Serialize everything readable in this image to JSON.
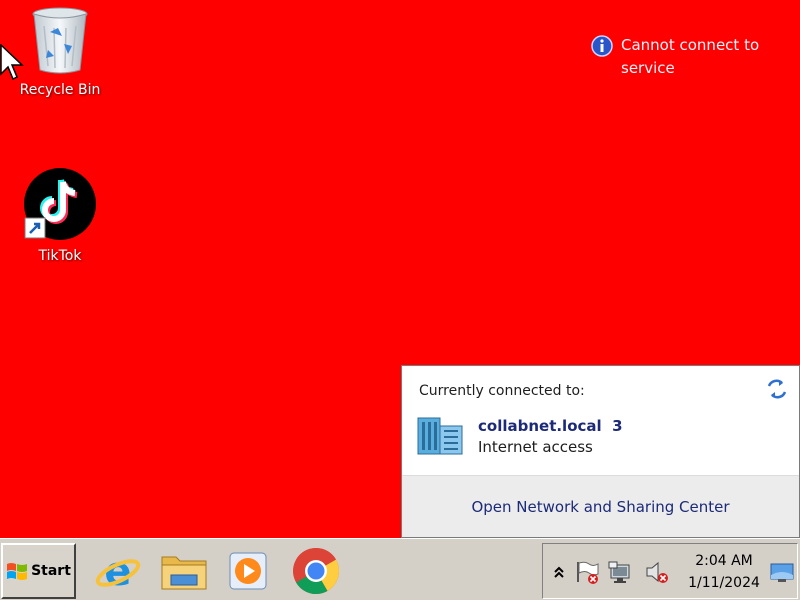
{
  "desktop": {
    "background_color": "#ff0000",
    "icons": [
      {
        "label": "Recycle Bin",
        "icon": "recycle-bin-icon"
      },
      {
        "label": "TikTok",
        "icon": "tiktok-icon"
      }
    ]
  },
  "notice": {
    "icon": "info-icon",
    "text": "Cannot connect to service"
  },
  "network_flyout": {
    "header": "Currently connected to:",
    "refresh_icon": "refresh-icon",
    "network_name": "collabnet.local",
    "network_number": "3",
    "network_status": "Internet access",
    "network_icon": "network-building-icon",
    "footer_link": "Open Network and Sharing Center",
    "link_color": "#1c2a78"
  },
  "taskbar": {
    "start_label": "Start",
    "apps": [
      {
        "name": "Internet Explorer",
        "icon": "internet-explorer-icon"
      },
      {
        "name": "File Explorer",
        "icon": "folder-icon"
      },
      {
        "name": "Media Player",
        "icon": "media-player-icon"
      },
      {
        "name": "Google Chrome",
        "icon": "chrome-icon"
      }
    ],
    "tray": {
      "icons": [
        "show-hidden-icons-chevron",
        "action-center-flag-icon",
        "network-icon",
        "volume-muted-icon"
      ],
      "time": "2:04 AM",
      "date": "1/11/2024"
    }
  }
}
